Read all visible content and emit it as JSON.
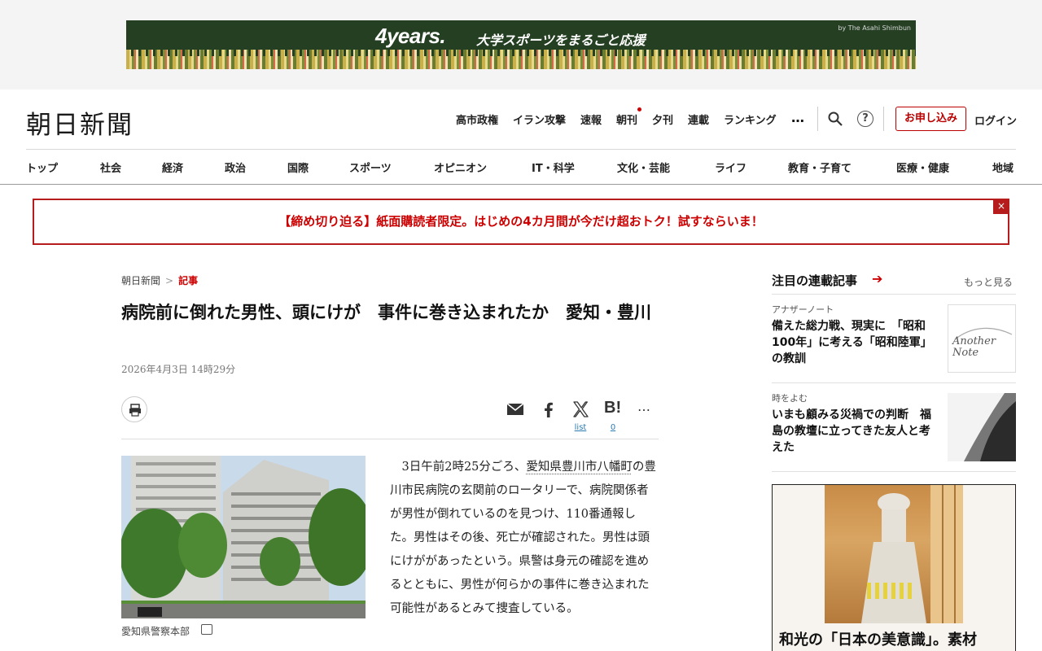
{
  "ad_top": {
    "brand": "4years.",
    "tagline": "大学スポーツをまるごと応援",
    "by": "by The Asahi Shimbun"
  },
  "header": {
    "logo": "朝日新聞",
    "top_nav": [
      "高市政権",
      "イラン攻撃",
      "速報",
      "朝刊",
      "夕刊",
      "連載",
      "ランキング"
    ],
    "more": "…",
    "help": "?",
    "subscribe": "お申し込み",
    "login": "ログイン",
    "section_nav": [
      "トップ",
      "社会",
      "経済",
      "政治",
      "国際",
      "スポーツ",
      "オピニオン",
      "IT・科学",
      "文化・芸能",
      "ライフ",
      "教育・子育て",
      "医療・健康",
      "地域"
    ]
  },
  "promo": {
    "text": "【締め切り迫る】紙面購読者限定。はじめの4カ月間が今だけ超おトク！試すならいま！",
    "close": "×"
  },
  "article": {
    "breadcrumb": [
      "朝日新聞",
      "記事"
    ],
    "breadcrumb_sep": ">",
    "title": "病院前に倒れた男性、頭にけが　事件に巻き込まれたか　愛知・豊川",
    "date": "2026年4月3日 14時29分",
    "share": {
      "list_label": "list",
      "hatena_label": "B!",
      "hatena_count": "0",
      "more": "…"
    },
    "photo_caption": "愛知県警察本部",
    "body_pre": "3日午前2時25分ごろ、",
    "body_link": "愛知県豊川市八幡町",
    "body_post": "の豊川市民病院の玄関前のロータリーで、病院関係者が男性が倒れているのを見つけ、110番通報した。男性はその後、死亡が確認された。男性は頭にけががあったという。県警は身元の確認を進めるとともに、男性が何らかの事件に巻き込まれた可能性があるとみて捜査している。"
  },
  "sidebar": {
    "title": "注目の連載記事",
    "arrow": "➔",
    "more": "もっと見る",
    "items": [
      {
        "tag": "アナザーノート",
        "headline": "備えた総力戦、現実に　「昭和100年」に考える「昭和陸軍」の教訓",
        "thumb_text_1": "Another",
        "thumb_text_2": "Note"
      },
      {
        "tag": "時をよむ",
        "headline": "いまも顧みる災禍での判断　福島の教壇に立ってきた友人と考えた"
      }
    ],
    "ad_text": "和光の「日本の美意識」。素材"
  }
}
